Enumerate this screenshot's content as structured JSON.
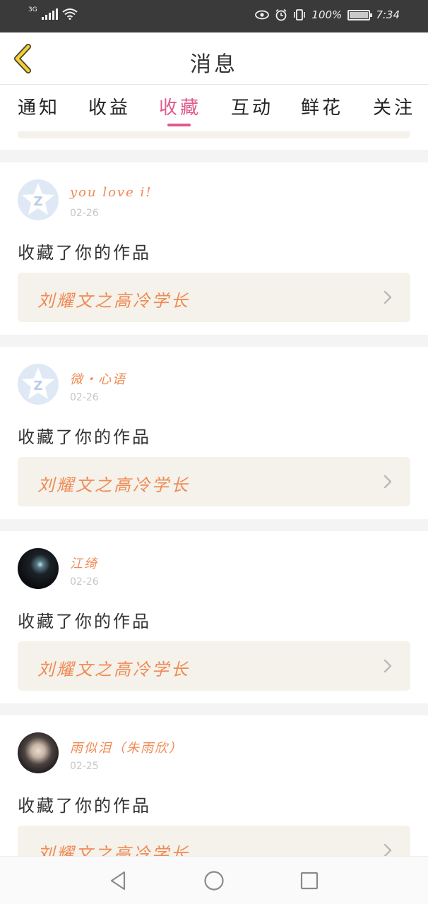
{
  "status_bar": {
    "network": "3G",
    "battery": "100%",
    "time": "7:34"
  },
  "header": {
    "title": "消息",
    "back_icon": "chevron-left-icon"
  },
  "tabs": [
    {
      "label": "通知",
      "active": false
    },
    {
      "label": "收益",
      "active": false
    },
    {
      "label": "收藏",
      "active": true
    },
    {
      "label": "互动",
      "active": false
    },
    {
      "label": "鲜花",
      "active": false
    },
    {
      "label": "关注",
      "active": false
    }
  ],
  "messages": [
    {
      "user": "you love i!",
      "date": "02-26",
      "text": "收藏了你的作品",
      "work_title": "刘耀文之高冷学长",
      "avatar": "qq-default-avatar"
    },
    {
      "user": "微・心语",
      "date": "02-26",
      "text": "收藏了你的作品",
      "work_title": "刘耀文之高冷学长",
      "avatar": "qq-default-avatar"
    },
    {
      "user": "江绮",
      "date": "02-26",
      "text": "收藏了你的作品",
      "work_title": "刘耀文之高冷学长",
      "avatar": "photo-avatar"
    },
    {
      "user": "雨似泪（朱雨欣）",
      "date": "02-25",
      "text": "收藏了你的作品",
      "work_title": "刘耀文之高冷学长",
      "avatar": "photo-avatar"
    }
  ],
  "colors": {
    "accent_pink": "#e05a8d",
    "accent_orange": "#f08a55",
    "status_bar_bg": "#3a3a3a",
    "work_box_bg": "#f4f2ea"
  }
}
